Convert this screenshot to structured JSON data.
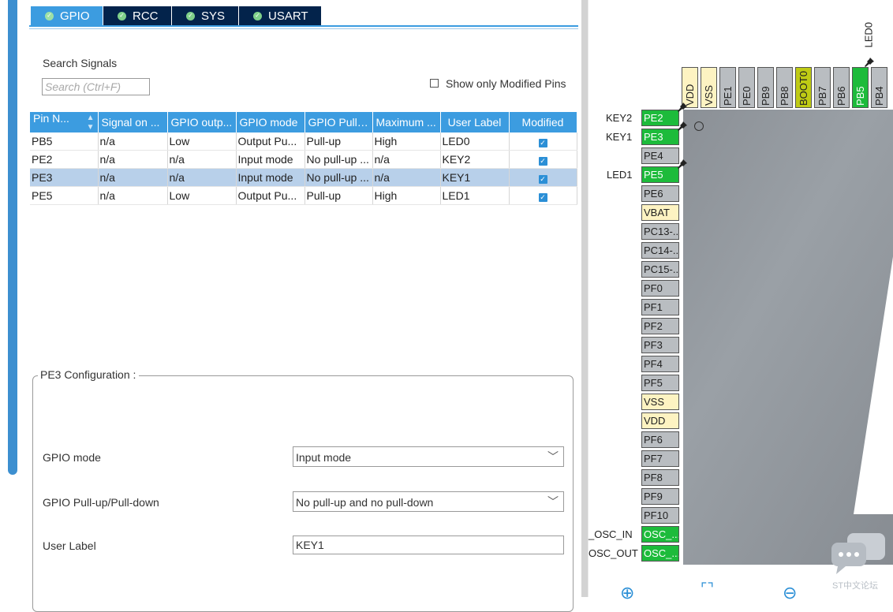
{
  "tabs": [
    {
      "label": "GPIO",
      "active": true
    },
    {
      "label": "RCC",
      "active": false
    },
    {
      "label": "SYS",
      "active": false
    },
    {
      "label": "USART",
      "active": false
    }
  ],
  "search": {
    "title": "Search Signals",
    "placeholder": "Search (Ctrl+F)",
    "modified_only_label": "Show only Modified Pins"
  },
  "table": {
    "headers": [
      "Pin N...",
      "Signal on ...",
      "GPIO outp...",
      "GPIO mode",
      "GPIO Pull-...",
      "Maximum ...",
      "User Label",
      "Modified"
    ],
    "rows": [
      {
        "pin": "PB5",
        "signal": "n/a",
        "output": "Low",
        "mode": "Output Pu...",
        "pull": "Pull-up",
        "speed": "High",
        "label": "LED0",
        "modified": true,
        "selected": false
      },
      {
        "pin": "PE2",
        "signal": "n/a",
        "output": "n/a",
        "mode": "Input mode",
        "pull": "No pull-up ...",
        "speed": "n/a",
        "label": "KEY2",
        "modified": true,
        "selected": false
      },
      {
        "pin": "PE3",
        "signal": "n/a",
        "output": "n/a",
        "mode": "Input mode",
        "pull": "No pull-up ...",
        "speed": "n/a",
        "label": "KEY1",
        "modified": true,
        "selected": true
      },
      {
        "pin": "PE5",
        "signal": "n/a",
        "output": "Low",
        "mode": "Output Pu...",
        "pull": "Pull-up",
        "speed": "High",
        "label": "LED1",
        "modified": true,
        "selected": false
      }
    ]
  },
  "config": {
    "title": "PE3 Configuration :",
    "gpio_mode_label": "GPIO mode",
    "gpio_mode_value": "Input mode",
    "pull_label": "GPIO Pull-up/Pull-down",
    "pull_value": "No pull-up and no pull-down",
    "user_label_label": "User Label",
    "user_label_value": "KEY1"
  },
  "chip": {
    "top_pins": [
      {
        "name": "VDD",
        "color": "yellow"
      },
      {
        "name": "VSS",
        "color": "yellow"
      },
      {
        "name": "PE1",
        "color": "grey"
      },
      {
        "name": "PE0",
        "color": "grey"
      },
      {
        "name": "PB9",
        "color": "grey"
      },
      {
        "name": "PB8",
        "color": "grey"
      },
      {
        "name": "BOOT0",
        "color": "olive"
      },
      {
        "name": "PB7",
        "color": "grey"
      },
      {
        "name": "PB6",
        "color": "grey"
      },
      {
        "name": "PB5",
        "color": "green"
      },
      {
        "name": "PB4",
        "color": "grey"
      }
    ],
    "left_pins": [
      {
        "name": "PE2",
        "color": "green"
      },
      {
        "name": "PE3",
        "color": "green"
      },
      {
        "name": "PE4",
        "color": "grey"
      },
      {
        "name": "PE5",
        "color": "green"
      },
      {
        "name": "PE6",
        "color": "grey"
      },
      {
        "name": "VBAT",
        "color": "yellow"
      },
      {
        "name": "PC13-...",
        "color": "grey"
      },
      {
        "name": "PC14-...",
        "color": "grey"
      },
      {
        "name": "PC15-...",
        "color": "grey"
      },
      {
        "name": "PF0",
        "color": "grey"
      },
      {
        "name": "PF1",
        "color": "grey"
      },
      {
        "name": "PF2",
        "color": "grey"
      },
      {
        "name": "PF3",
        "color": "grey"
      },
      {
        "name": "PF4",
        "color": "grey"
      },
      {
        "name": "PF5",
        "color": "grey"
      },
      {
        "name": "VSS",
        "color": "yellow"
      },
      {
        "name": "VDD",
        "color": "yellow"
      },
      {
        "name": "PF6",
        "color": "grey"
      },
      {
        "name": "PF7",
        "color": "grey"
      },
      {
        "name": "PF8",
        "color": "grey"
      },
      {
        "name": "PF9",
        "color": "grey"
      },
      {
        "name": "PF10",
        "color": "grey"
      },
      {
        "name": "OSC_...",
        "color": "green"
      },
      {
        "name": "OSC_...",
        "color": "green"
      }
    ],
    "ext_labels": {
      "led0": "LED0",
      "key2": "KEY2",
      "key1": "KEY1",
      "led1": "LED1",
      "osc_in": "_OSC_IN",
      "osc_out": "OSC_OUT"
    }
  },
  "watermark": "ST中文论坛",
  "colors": {
    "accent": "#3c9ce0",
    "tab_dark": "#03234b",
    "pin_green": "#1dbb3b"
  }
}
